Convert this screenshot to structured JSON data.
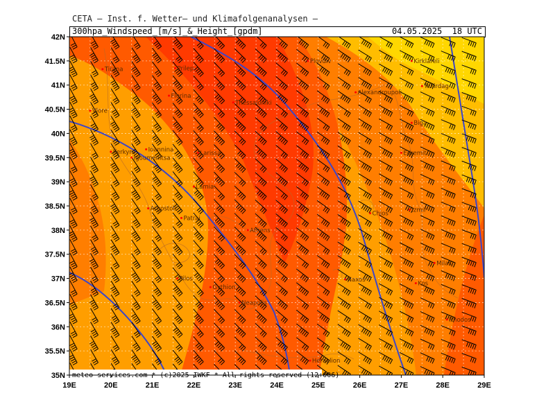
{
  "header": {
    "org": "CETA – Inst. f. Wetter– und Klimafolgenanalysen –",
    "product": "300hpa_Windspeed_[m/s]_&_Height_[gpdm]",
    "valid_time": "04.05.2025  18 UTC"
  },
  "footer": {
    "credit": "meteo-services.com * (c)2025 IWKF * All rights reserved (12+006)"
  },
  "axes": {
    "lon_ticks": [
      "19E",
      "20E",
      "21E",
      "22E",
      "23E",
      "24E",
      "25E",
      "26E",
      "27E",
      "28E",
      "29E"
    ],
    "lat_ticks": [
      "35N",
      "35.5N",
      "36N",
      "36.5N",
      "37N",
      "37.5N",
      "38N",
      "38.5N",
      "39N",
      "39.5N",
      "40N",
      "40.5N",
      "41N",
      "41.5N",
      "42N"
    ]
  },
  "cities": [
    {
      "name": "Tirana",
      "lon": 19.8,
      "lat": 41.33
    },
    {
      "name": "Prilep",
      "lon": 21.55,
      "lat": 41.35
    },
    {
      "name": "Florina",
      "lon": 21.4,
      "lat": 40.78
    },
    {
      "name": "Thessaloniki",
      "lon": 22.95,
      "lat": 40.64
    },
    {
      "name": "Plovdiv",
      "lon": 24.75,
      "lat": 41.5
    },
    {
      "name": "Alexandroupoli",
      "lon": 25.9,
      "lat": 40.85
    },
    {
      "name": "Kirklareli",
      "lon": 27.25,
      "lat": 41.5
    },
    {
      "name": "Tekirdag",
      "lon": 27.5,
      "lat": 40.98
    },
    {
      "name": "Biga",
      "lon": 27.25,
      "lat": 40.22
    },
    {
      "name": "Vlore",
      "lon": 19.5,
      "lat": 40.47
    },
    {
      "name": "Kerkyra",
      "lon": 20.0,
      "lat": 39.62
    },
    {
      "name": "Ioannina",
      "lon": 20.85,
      "lat": 39.67
    },
    {
      "name": "Igoumenitsa",
      "lon": 20.5,
      "lat": 39.5
    },
    {
      "name": "Larissa",
      "lon": 22.1,
      "lat": 39.6
    },
    {
      "name": "Edremit",
      "lon": 27.0,
      "lat": 39.6
    },
    {
      "name": "Lamia",
      "lon": 22.0,
      "lat": 38.9
    },
    {
      "name": "Argostoli",
      "lon": 20.9,
      "lat": 38.45
    },
    {
      "name": "Patrai",
      "lon": 21.7,
      "lat": 38.25
    },
    {
      "name": "Athens",
      "lon": 23.3,
      "lat": 38.0
    },
    {
      "name": "Chios",
      "lon": 26.25,
      "lat": 38.35
    },
    {
      "name": "Izmir",
      "lon": 27.2,
      "lat": 38.42
    },
    {
      "name": "Milas",
      "lon": 27.8,
      "lat": 37.32
    },
    {
      "name": "Pilos",
      "lon": 21.6,
      "lat": 37.0
    },
    {
      "name": "Gythion",
      "lon": 22.4,
      "lat": 36.82
    },
    {
      "name": "Naxos",
      "lon": 25.65,
      "lat": 36.98
    },
    {
      "name": "Kos",
      "lon": 27.35,
      "lat": 36.9
    },
    {
      "name": "Neapolis",
      "lon": 23.1,
      "lat": 36.5
    },
    {
      "name": "Rhodos",
      "lon": 28.1,
      "lat": 36.15
    },
    {
      "name": "Heraklion",
      "lon": 24.8,
      "lat": 35.3
    }
  ],
  "colors": {
    "darkest": "#ff3a00",
    "dark": "#ff5a00",
    "mid": "#ff7e00",
    "light": "#ff9e00",
    "lighter": "#ffbd00",
    "lightest": "#ffd700",
    "contour": "#3c46c8",
    "barb": "#000000",
    "coast": "#b86a28"
  }
}
